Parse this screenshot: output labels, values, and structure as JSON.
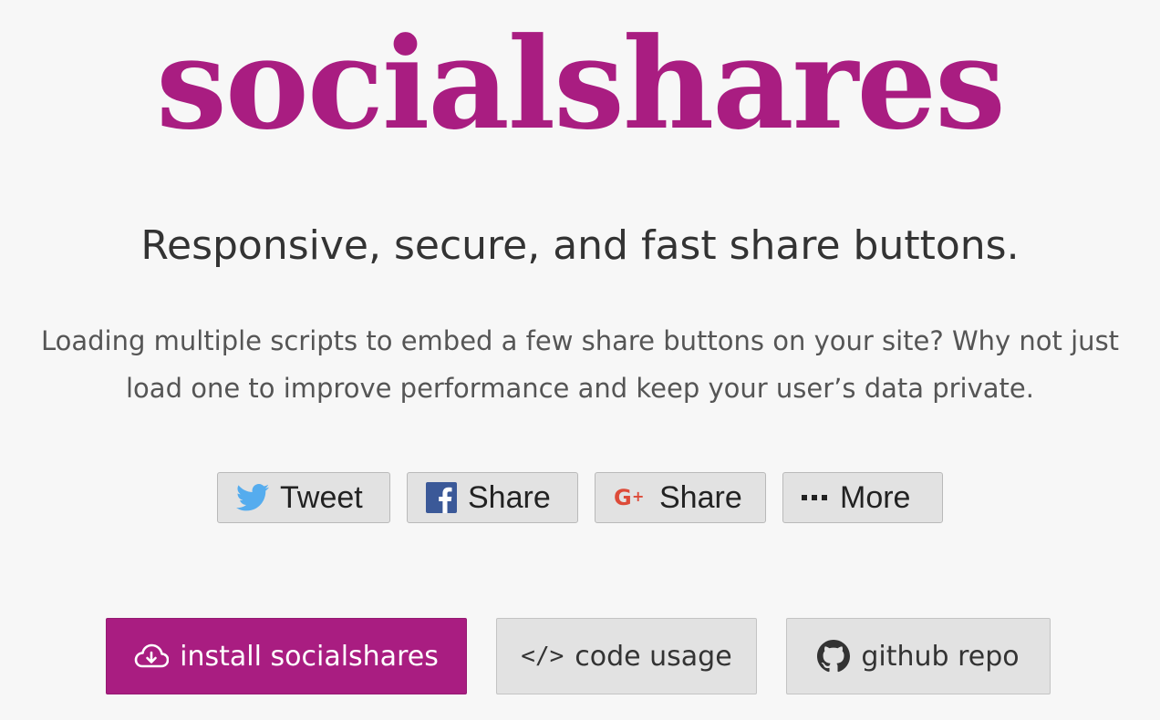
{
  "header": {
    "logo_text": "socialshares"
  },
  "hero": {
    "tagline": "Responsive, secure, and fast share buttons.",
    "description": "Loading multiple scripts to embed a few share buttons on your site? Why not just load one to improve performance and keep your user’s data private."
  },
  "share_buttons": [
    {
      "label": "Tweet",
      "icon": "twitter-bird-icon",
      "icon_color": "#55acee"
    },
    {
      "label": "Share",
      "icon": "facebook-f-icon",
      "icon_color": "#3b5998"
    },
    {
      "label": "Share",
      "icon": "google-plus-icon",
      "icon_color": "#dd4b39"
    },
    {
      "label": "More",
      "icon": "ellipsis-icon",
      "icon_color": "#222222"
    }
  ],
  "actions": {
    "install": {
      "label": "install socialshares",
      "icon": "cloud-download-icon"
    },
    "code_usage": {
      "label": "code usage",
      "icon": "code-brackets-icon",
      "icon_glyph": "</>"
    },
    "github": {
      "label": "github repo",
      "icon": "github-octocat-icon"
    }
  },
  "colors": {
    "brand": "#a91d81",
    "background": "#f7f7f7",
    "button_gray": "#e2e2e2",
    "text_dark": "#333333"
  }
}
